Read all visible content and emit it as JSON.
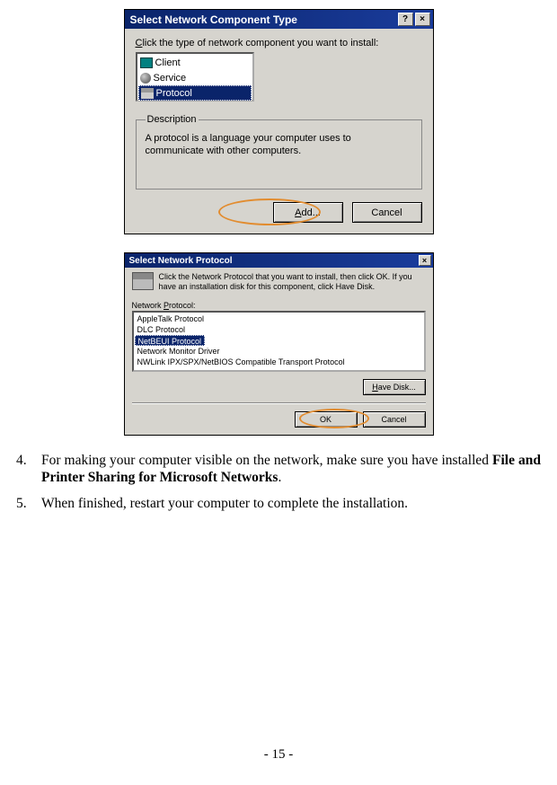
{
  "dialog1": {
    "title": "Select Network Component Type",
    "help_button": "?",
    "close_button": "×",
    "prompt_pre": "C",
    "prompt_post": "lick the type of network component you want to install:",
    "items": [
      {
        "label": "Client"
      },
      {
        "label": "Service"
      },
      {
        "label": "Protocol"
      }
    ],
    "description_legend": "Description",
    "description_text": "A protocol is a language your computer uses to communicate with other computers.",
    "add_pre": "A",
    "add_post": "dd...",
    "cancel": "Cancel"
  },
  "dialog2": {
    "title": "Select Network Protocol",
    "close_button": "×",
    "instruction": "Click the Network Protocol that you want to install, then click OK. If you have an installation disk for this component, click Have Disk.",
    "list_label_pre": "Network ",
    "list_label_u": "P",
    "list_label_post": "rotocol:",
    "items": [
      {
        "label": "AppleTalk Protocol"
      },
      {
        "label": "DLC Protocol"
      },
      {
        "label": "NetBEUI Protocol"
      },
      {
        "label": "Network Monitor Driver"
      },
      {
        "label": "NWLink IPX/SPX/NetBIOS Compatible Transport Protocol"
      }
    ],
    "have_disk_u": "H",
    "have_disk_post": "ave Disk...",
    "ok": "OK",
    "cancel": "Cancel"
  },
  "steps": {
    "s4_num": "4.",
    "s4_a": "For making your computer visible on the network,  make sure you have installed ",
    "s4_b": "File and Printer Sharing for Microsoft Networks",
    "s4_c": ".",
    "s5_num": "5.",
    "s5_a": "When finished, restart your computer to complete the installation."
  },
  "page_number": "- 15 -"
}
